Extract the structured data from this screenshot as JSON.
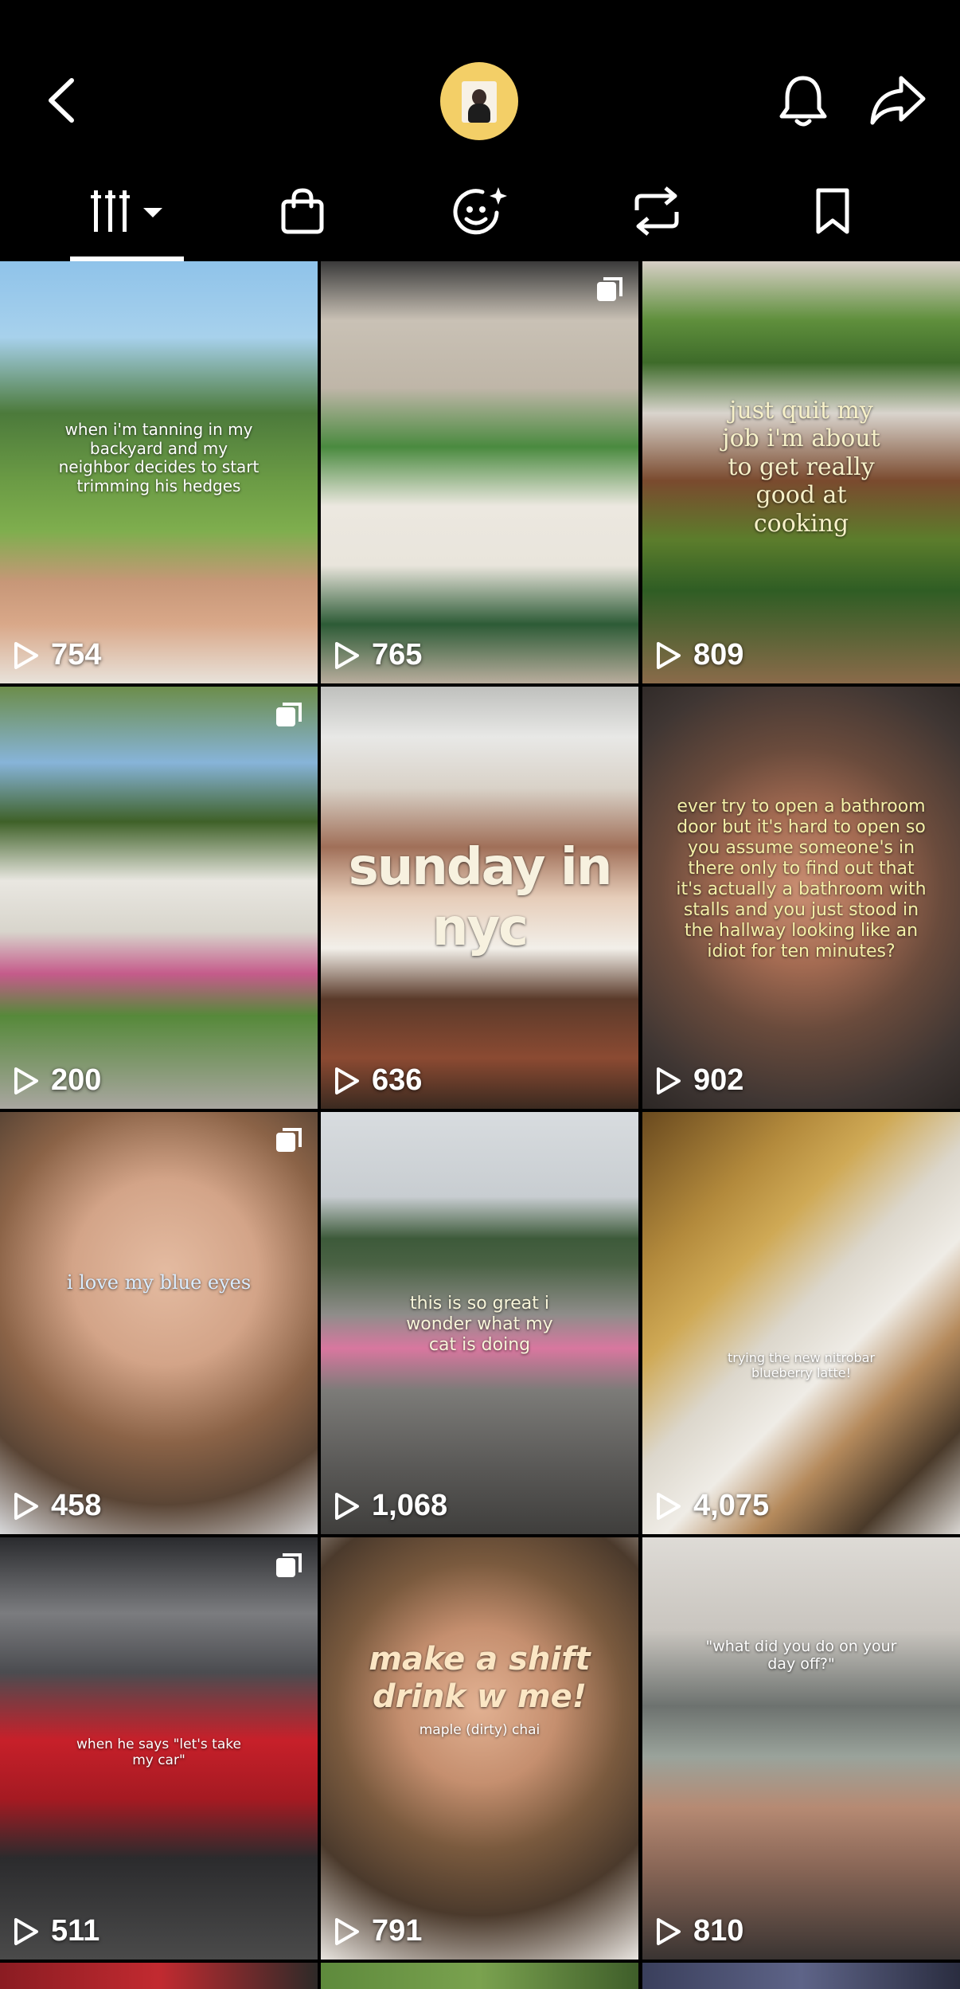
{
  "header": {
    "back_icon": "chevron-left-icon",
    "avatar_icon": "profile-avatar",
    "bell_icon": "bell-icon",
    "share_icon": "share-arrow-icon"
  },
  "tabs": [
    {
      "name": "videos",
      "icon": "grid-filter-icon",
      "active": true
    },
    {
      "name": "shop",
      "icon": "shopping-bag-icon",
      "active": false
    },
    {
      "name": "favorites",
      "icon": "sparkle-face-icon",
      "active": false
    },
    {
      "name": "reposts",
      "icon": "repost-icon",
      "active": false
    },
    {
      "name": "saved",
      "icon": "bookmark-icon",
      "active": false
    }
  ],
  "colors": {
    "background": "#000000",
    "accent": "#ffffff",
    "avatar_ring": "#f3cf67"
  },
  "videos": [
    {
      "views": "754",
      "caption": "when i'm tanning in my backyard and my neighbor decides to start trimming his hedges",
      "multi": false
    },
    {
      "views": "765",
      "caption": "",
      "multi": true
    },
    {
      "views": "809",
      "caption": "just quit my job i'm about to get really good at cooking",
      "multi": false
    },
    {
      "views": "200",
      "caption": "",
      "multi": true
    },
    {
      "views": "636",
      "caption": "sunday in nyc",
      "multi": false
    },
    {
      "views": "902",
      "caption": "ever try to open a bathroom door but it's hard to open so you assume someone's in there only to find out that it's actually a bathroom with stalls and you just stood in the hallway looking like an idiot for ten minutes?",
      "multi": false
    },
    {
      "views": "458",
      "caption": "i love my blue eyes",
      "multi": true
    },
    {
      "views": "1,068",
      "caption": "this is so great i wonder what my cat is doing",
      "multi": false
    },
    {
      "views": "4,075",
      "caption": "trying the new nitrobar blueberry latte!",
      "multi": false
    },
    {
      "views": "511",
      "caption": "when he says \"let's take my car\"",
      "multi": true
    },
    {
      "views": "791",
      "caption": "make a shift drink w me!",
      "caption2": "maple (dirty) chai",
      "multi": false
    },
    {
      "views": "810",
      "caption": "\"what did you do on your day off?\"",
      "multi": false
    }
  ]
}
